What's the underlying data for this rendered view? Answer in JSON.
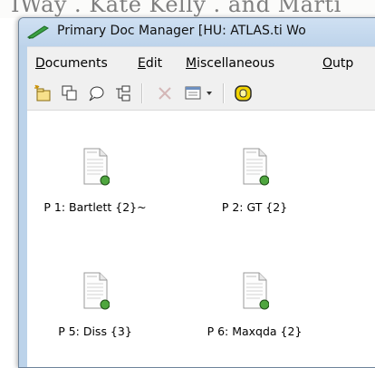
{
  "background_document": {
    "text": "IWay . Kate Kelly . and Marti"
  },
  "window": {
    "title": "Primary Doc Manager [HU: ATLAS.ti Wo"
  },
  "menubar": {
    "items": [
      {
        "label": "Documents",
        "accel": "D",
        "rest": "ocuments"
      },
      {
        "label": "Edit",
        "accel": "E",
        "rest": "dit"
      },
      {
        "label": "Miscellaneous",
        "accel": "M",
        "rest": "iscellaneous"
      },
      {
        "label": "Outp",
        "accel": "O",
        "rest": "utp"
      }
    ]
  },
  "toolbar": {
    "buttons": [
      {
        "icon": "new-document-icon"
      },
      {
        "icon": "copy-icon"
      },
      {
        "icon": "comment-icon"
      },
      {
        "icon": "tree-icon"
      },
      {
        "icon": "delete-icon",
        "disabled": true
      },
      {
        "icon": "view-options-icon"
      },
      {
        "icon": "highlight-icon"
      }
    ]
  },
  "documents": [
    {
      "label": "P 1: Bartlett {2}~"
    },
    {
      "label": "P 2: GT {2}"
    },
    {
      "label": "P 5: Diss {3}"
    },
    {
      "label": "P 6: Maxqda {2}"
    }
  ],
  "colors": {
    "titlebar": "#bcd3ea",
    "status_dot": "#4fa63f",
    "highlight": "#f2d400"
  }
}
